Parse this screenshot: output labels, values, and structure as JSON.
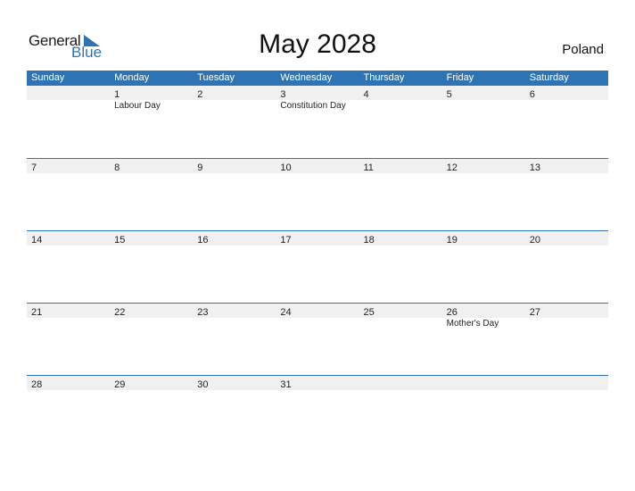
{
  "logo": {
    "general": "General",
    "blue": "Blue"
  },
  "title": "May 2028",
  "country": "Poland",
  "colors": {
    "accent": "#2e74b5",
    "band": "#f0f0f0"
  },
  "weekdays": [
    "Sunday",
    "Monday",
    "Tuesday",
    "Wednesday",
    "Thursday",
    "Friday",
    "Saturday"
  ],
  "weeks": [
    [
      {
        "d": ""
      },
      {
        "d": "1",
        "h": "Labour Day"
      },
      {
        "d": "2"
      },
      {
        "d": "3",
        "h": "Constitution Day"
      },
      {
        "d": "4"
      },
      {
        "d": "5"
      },
      {
        "d": "6"
      }
    ],
    [
      {
        "d": "7"
      },
      {
        "d": "8"
      },
      {
        "d": "9"
      },
      {
        "d": "10"
      },
      {
        "d": "11"
      },
      {
        "d": "12"
      },
      {
        "d": "13"
      }
    ],
    [
      {
        "d": "14"
      },
      {
        "d": "15"
      },
      {
        "d": "16"
      },
      {
        "d": "17"
      },
      {
        "d": "18"
      },
      {
        "d": "19"
      },
      {
        "d": "20"
      }
    ],
    [
      {
        "d": "21"
      },
      {
        "d": "22"
      },
      {
        "d": "23"
      },
      {
        "d": "24"
      },
      {
        "d": "25"
      },
      {
        "d": "26",
        "h": "Mother's Day"
      },
      {
        "d": "27"
      }
    ],
    [
      {
        "d": "28"
      },
      {
        "d": "29"
      },
      {
        "d": "30"
      },
      {
        "d": "31"
      },
      {
        "d": ""
      },
      {
        "d": ""
      },
      {
        "d": ""
      }
    ]
  ]
}
